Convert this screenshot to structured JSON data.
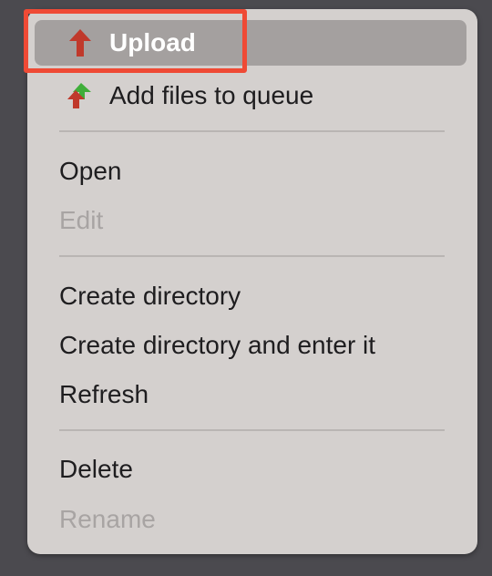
{
  "menu": {
    "items": [
      {
        "label": "Upload",
        "icon": "upload-arrow-icon",
        "state": "highlighted"
      },
      {
        "label": "Add files to queue",
        "icon": "add-to-queue-icon",
        "state": "enabled"
      },
      {
        "label": "Open",
        "state": "enabled"
      },
      {
        "label": "Edit",
        "state": "disabled"
      },
      {
        "label": "Create directory",
        "state": "enabled"
      },
      {
        "label": "Create directory and enter it",
        "state": "enabled"
      },
      {
        "label": "Refresh",
        "state": "enabled"
      },
      {
        "label": "Delete",
        "state": "enabled"
      },
      {
        "label": "Rename",
        "state": "disabled"
      }
    ]
  },
  "colors": {
    "menu_background": "#d4d0ce",
    "highlight_background": "#a4a09f",
    "disabled_text": "#a8a4a3",
    "annotation_border": "#ef4a35",
    "upload_arrow": "#c0392b",
    "queue_arrow_green": "#3fae3a"
  }
}
